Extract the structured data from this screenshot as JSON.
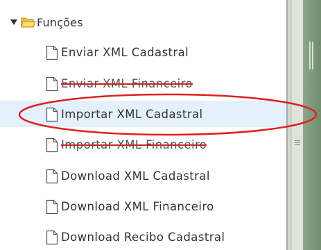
{
  "tree": {
    "root": {
      "label": "Funções",
      "toggle_icon": "triangle-down-icon",
      "icon": "folder-open-icon",
      "expanded": true
    },
    "items": [
      {
        "label": "Enviar XML Cadastral",
        "icon": "document-icon"
      },
      {
        "label": "Enviar XML Financeiro",
        "icon": "document-icon",
        "struck": true
      },
      {
        "label": "Importar XML Cadastral",
        "icon": "document-icon",
        "selected": true
      },
      {
        "label": "Importar XML Financeiro",
        "icon": "document-icon",
        "struck": true
      },
      {
        "label": "Download XML Cadastral",
        "icon": "document-icon"
      },
      {
        "label": "Download XML Financeiro",
        "icon": "document-icon"
      },
      {
        "label": "Download Recibo Cadastral",
        "icon": "document-icon"
      }
    ]
  },
  "annotation": {
    "shape": "ellipse",
    "color": "#e02020",
    "target": "Importar XML Cadastral"
  },
  "colors": {
    "selection": "#e4f1fb",
    "panel_green": "#7a9677",
    "text": "#333333"
  }
}
